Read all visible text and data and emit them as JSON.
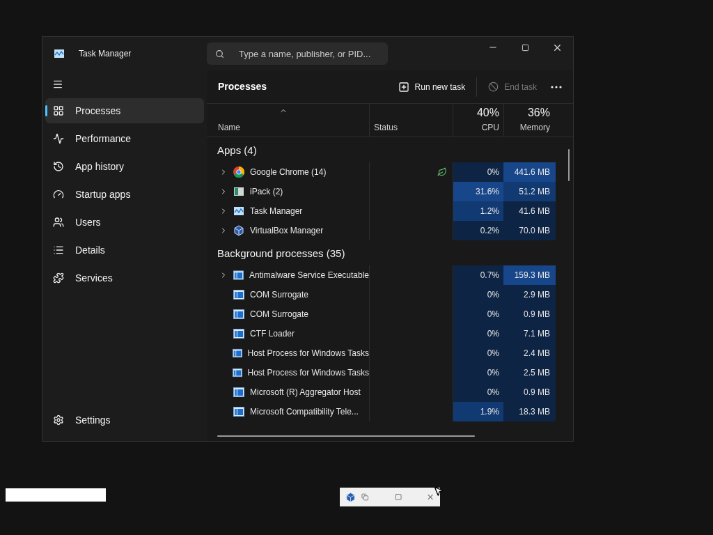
{
  "window": {
    "title": "Task Manager"
  },
  "search": {
    "placeholder": "Type a name, publisher, or PID..."
  },
  "sidebar": {
    "items": [
      {
        "label": "Processes",
        "selected": true
      },
      {
        "label": "Performance",
        "selected": false
      },
      {
        "label": "App history",
        "selected": false
      },
      {
        "label": "Startup apps",
        "selected": false
      },
      {
        "label": "Users",
        "selected": false
      },
      {
        "label": "Details",
        "selected": false
      },
      {
        "label": "Services",
        "selected": false
      }
    ],
    "footer": {
      "label": "Settings"
    }
  },
  "toolbar": {
    "title": "Processes",
    "run_new_task": {
      "label": "Run new task",
      "disabled": false
    },
    "end_task": {
      "label": "End task",
      "disabled": true
    }
  },
  "table": {
    "columns": [
      {
        "label": "Name"
      },
      {
        "label": "Status"
      },
      {
        "label": "CPU",
        "total": "40%"
      },
      {
        "label": "Memory",
        "total": "36%"
      }
    ],
    "groups": [
      {
        "title": "Apps (4)",
        "rows": [
          {
            "name": "Google Chrome (14)",
            "expandable": true,
            "efficiency_mode": true,
            "cpu": {
              "value": "0%",
              "color": "#0e2444"
            },
            "memory": {
              "value": "441.6 MB",
              "color": "#17468a"
            }
          },
          {
            "name": "iPack (2)",
            "expandable": true,
            "efficiency_mode": false,
            "cpu": {
              "value": "31.6%",
              "color": "#17468a"
            },
            "memory": {
              "value": "51.2 MB",
              "color": "#123a72"
            }
          },
          {
            "name": "Task Manager",
            "expandable": true,
            "efficiency_mode": false,
            "cpu": {
              "value": "1.2%",
              "color": "#123a72"
            },
            "memory": {
              "value": "41.6 MB",
              "color": "#0e2444"
            }
          },
          {
            "name": "VirtualBox Manager",
            "expandable": true,
            "efficiency_mode": false,
            "cpu": {
              "value": "0.2%",
              "color": "#0e2444"
            },
            "memory": {
              "value": "70.0 MB",
              "color": "#0e2444"
            }
          }
        ]
      },
      {
        "title": "Background processes (35)",
        "rows": [
          {
            "name": "Antimalware Service Executable",
            "expandable": true,
            "efficiency_mode": false,
            "cpu": {
              "value": "0.7%",
              "color": "#0e2444"
            },
            "memory": {
              "value": "159.3 MB",
              "color": "#17468a"
            }
          },
          {
            "name": "COM Surrogate",
            "expandable": false,
            "efficiency_mode": false,
            "cpu": {
              "value": "0%",
              "color": "#0e2444"
            },
            "memory": {
              "value": "2.9 MB",
              "color": "#0e2444"
            }
          },
          {
            "name": "COM Surrogate",
            "expandable": false,
            "efficiency_mode": false,
            "cpu": {
              "value": "0%",
              "color": "#0e2444"
            },
            "memory": {
              "value": "0.9 MB",
              "color": "#0e2444"
            }
          },
          {
            "name": "CTF Loader",
            "expandable": false,
            "efficiency_mode": false,
            "cpu": {
              "value": "0%",
              "color": "#0e2444"
            },
            "memory": {
              "value": "7.1 MB",
              "color": "#0e2444"
            }
          },
          {
            "name": "Host Process for Windows Tasks",
            "expandable": false,
            "efficiency_mode": false,
            "cpu": {
              "value": "0%",
              "color": "#0e2444"
            },
            "memory": {
              "value": "2.4 MB",
              "color": "#0e2444"
            }
          },
          {
            "name": "Host Process for Windows Tasks",
            "expandable": false,
            "efficiency_mode": false,
            "cpu": {
              "value": "0%",
              "color": "#0e2444"
            },
            "memory": {
              "value": "2.5 MB",
              "color": "#0e2444"
            }
          },
          {
            "name": "Microsoft (R) Aggregator Host",
            "expandable": false,
            "efficiency_mode": false,
            "cpu": {
              "value": "0%",
              "color": "#0e2444"
            },
            "memory": {
              "value": "0.9 MB",
              "color": "#0e2444"
            }
          },
          {
            "name": "Microsoft Compatibility Tele...",
            "expandable": false,
            "efficiency_mode": false,
            "cpu": {
              "value": "1.9%",
              "color": "#123a72"
            },
            "memory": {
              "value": "18.3 MB",
              "color": "#0e2444"
            }
          }
        ]
      }
    ]
  }
}
